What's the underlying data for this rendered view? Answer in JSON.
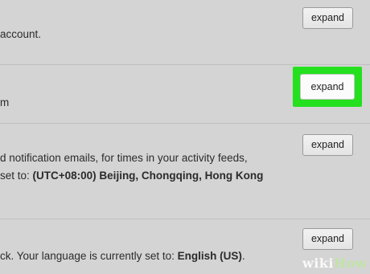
{
  "rows": [
    {
      "line1": "account.",
      "button": "expand"
    },
    {
      "line1": "m",
      "button": "expand"
    },
    {
      "line1": "d notification emails, for times in your activity feeds,",
      "line2_prefix": "set to: ",
      "line2_bold": "(UTC+08:00) Beijing, Chongqing, Hong Kong",
      "button": "expand"
    },
    {
      "line1_prefix": "ck. Your language is currently set to: ",
      "line1_bold": "English (US)",
      "line1_suffix": ".",
      "button": "expand"
    }
  ],
  "watermark": {
    "wiki": "wiki",
    "how": "How"
  }
}
